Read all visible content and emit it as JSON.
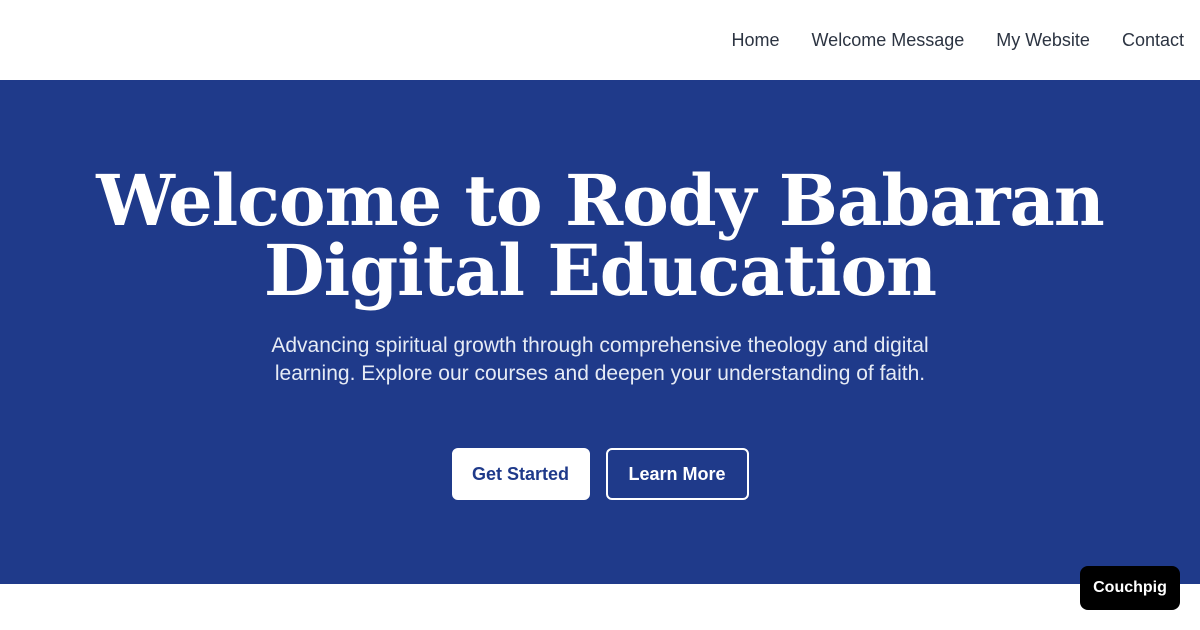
{
  "nav": {
    "items": [
      {
        "label": "Home"
      },
      {
        "label": "Welcome Message"
      },
      {
        "label": "My Website"
      },
      {
        "label": "Contact"
      }
    ]
  },
  "hero": {
    "title_line1": "Welcome to Rody Babaran",
    "title_line2": "Digital Education",
    "subtitle": "Advancing spiritual growth through comprehensive theology and digital learning. Explore our courses and deepen your understanding of faith.",
    "primary_button": "Get Started",
    "secondary_button": "Learn More"
  },
  "badge": {
    "label": "Couchpig"
  },
  "colors": {
    "hero_background": "#1f3a8a",
    "page_background": "#ffffff",
    "badge_background": "#000000"
  }
}
